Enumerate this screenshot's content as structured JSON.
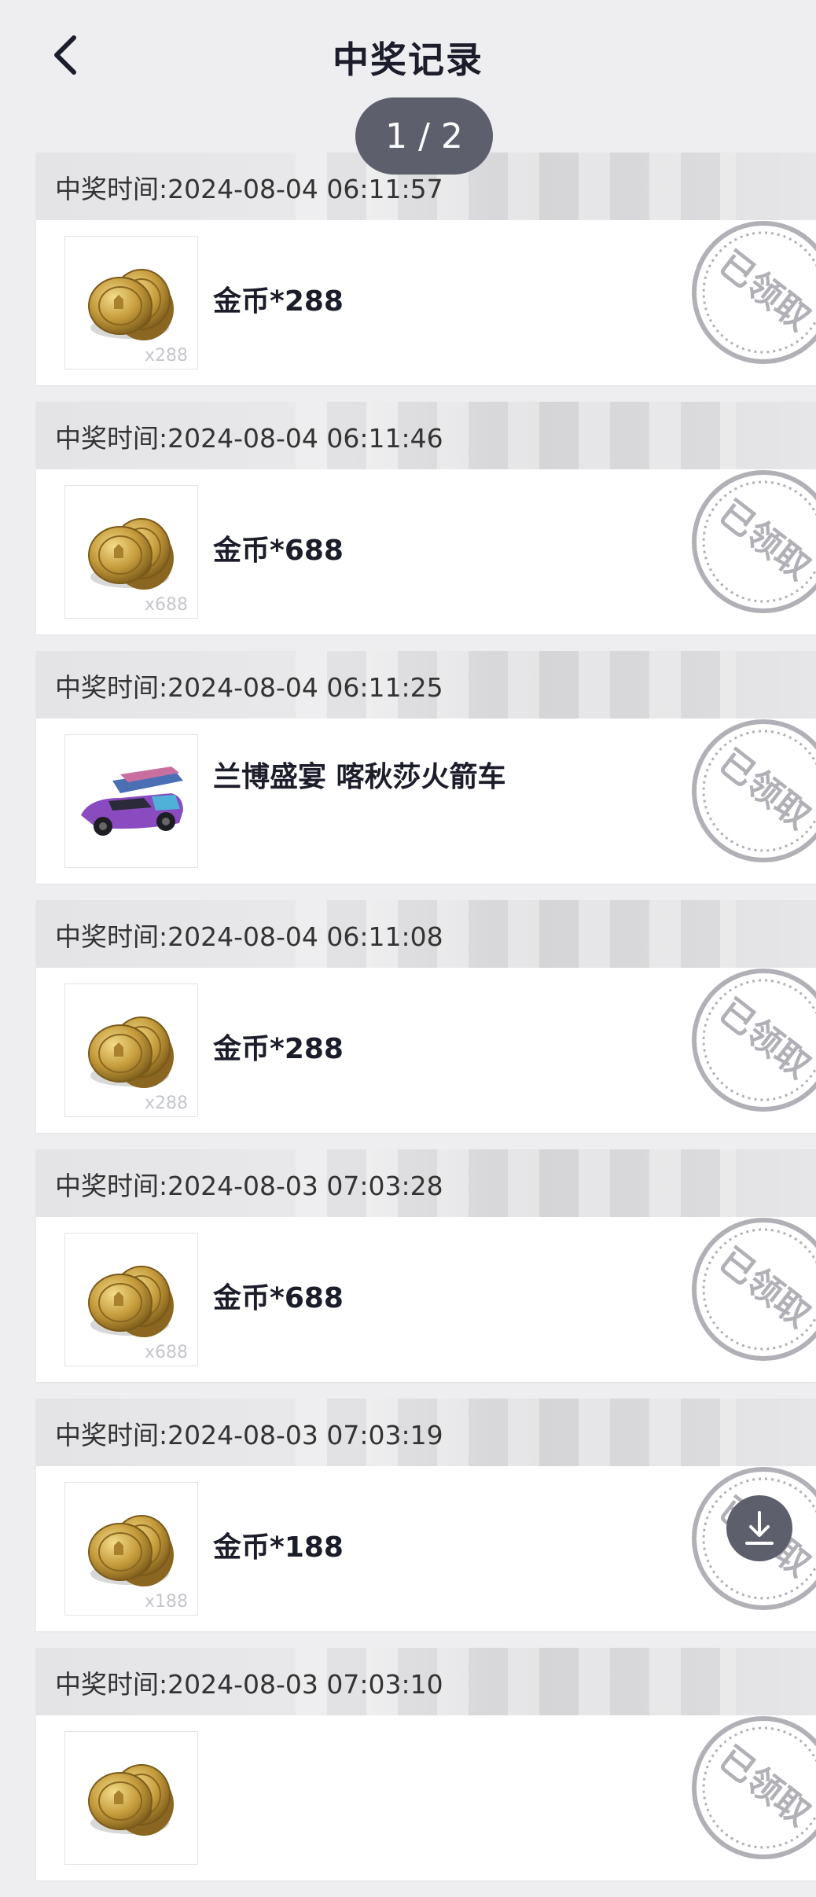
{
  "header": {
    "title": "中奖记录",
    "back_icon": "chevron-left-icon"
  },
  "pager": "1 / 2",
  "stamp_text": "已领取",
  "records": [
    {
      "time": "中奖时间:2024-08-04 06:11:57",
      "name": "金币*288",
      "type": "coin",
      "qty": "x288"
    },
    {
      "time": "中奖时间:2024-08-04 06:11:46",
      "name": "金币*688",
      "type": "coin",
      "qty": "x688"
    },
    {
      "time": "中奖时间:2024-08-04 06:11:25",
      "name": "兰博盛宴 喀秋莎火箭车",
      "type": "car",
      "qty": ""
    },
    {
      "time": "中奖时间:2024-08-04 06:11:08",
      "name": "金币*288",
      "type": "coin",
      "qty": "x288"
    },
    {
      "time": "中奖时间:2024-08-03 07:03:28",
      "name": "金币*688",
      "type": "coin",
      "qty": "x688"
    },
    {
      "time": "中奖时间:2024-08-03 07:03:19",
      "name": "金币*188",
      "type": "coin",
      "qty": "x188"
    },
    {
      "time": "中奖时间:2024-08-03 07:03:10",
      "name": "",
      "type": "coin",
      "qty": ""
    }
  ],
  "download_icon": "download-icon",
  "colors": {
    "background": "#eeeef0",
    "pill": "#5d5f6c",
    "stamp": "#b0b0b6",
    "text": "#1c1d2b"
  }
}
